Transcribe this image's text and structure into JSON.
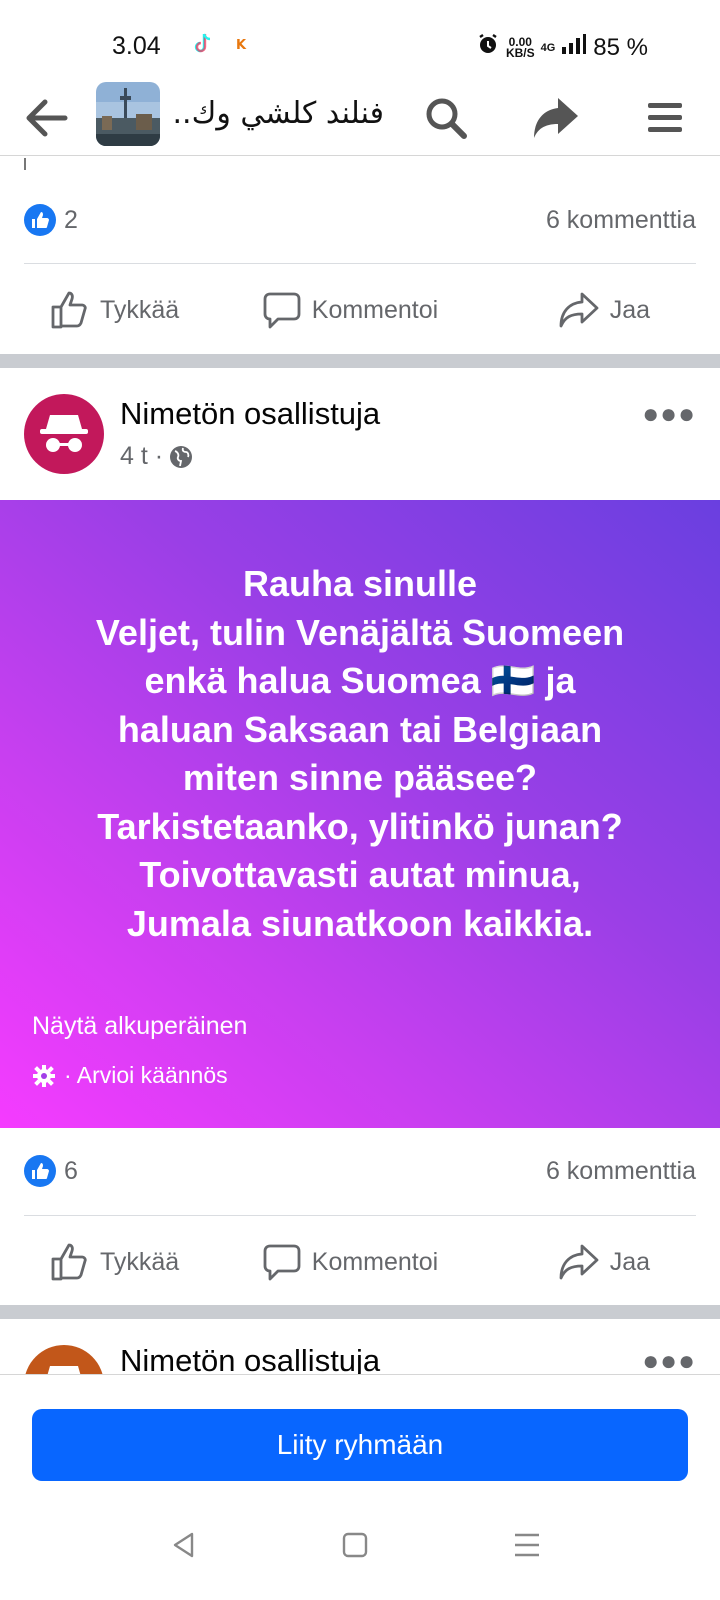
{
  "status_bar": {
    "time": "3.04",
    "net_speed_value": "0.00",
    "net_speed_unit": "KB/S",
    "network_type": "4G",
    "battery": "85 %"
  },
  "nav": {
    "group_title": "فنلند كلشي وك..."
  },
  "prev_post": {
    "like_count": "2",
    "comment_count": "6 kommenttia"
  },
  "actions": {
    "like": "Tykkää",
    "comment": "Kommentoi",
    "share": "Jaa"
  },
  "post": {
    "author": "Nimetön osallistuja",
    "time": "4 t ·",
    "text": "Rauha sinulle\nVeljet, tulin Venäjältä Suomeen\nenkä halua Suomea 🇫🇮 ja\nhaluan Saksaan tai Belgiaan\nmiten sinne pääsee?\nTarkistetaanko, ylitinkö junan?\nToivottavasti autat minua,\nJumala siunatkoon kaikkia.",
    "see_original": "Näytä alkuperäinen",
    "rate_translation": "· Arvioi käännös",
    "like_count": "6",
    "comment_count": "6 kommenttia",
    "background_gradient": [
      "#f53bff",
      "#6a3fe0"
    ]
  },
  "next_post": {
    "author": "Nimetön osallistuja"
  },
  "join_button": "Liity ryhmään",
  "colors": {
    "brand_blue": "#0866ff",
    "like_blue": "#1877f2",
    "anon_avatar_1": "#c2185b",
    "anon_avatar_2": "#c2571a"
  }
}
